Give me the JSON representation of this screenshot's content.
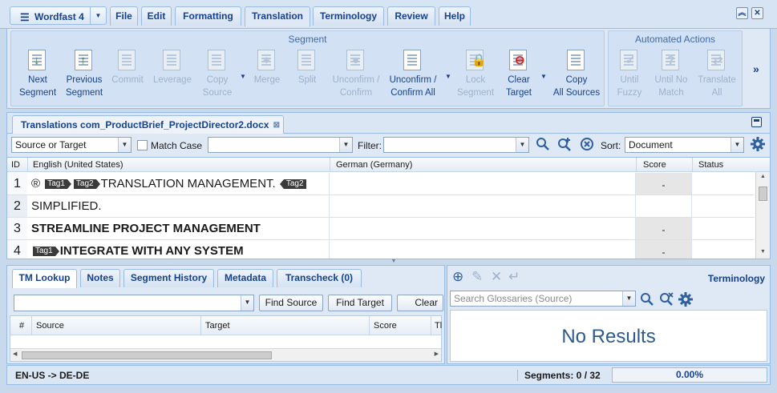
{
  "app": {
    "menu_label": "Wordfast 4"
  },
  "menu_tabs": [
    {
      "label": "File"
    },
    {
      "label": "Edit"
    },
    {
      "label": "Formatting"
    },
    {
      "label": "Translation"
    },
    {
      "label": "Terminology"
    },
    {
      "label": "Review"
    },
    {
      "label": "Help"
    }
  ],
  "active_menu_tab": "Translation",
  "ribbon": {
    "segment_group_title": "Segment",
    "automated_group_title": "Automated Actions",
    "buttons": [
      {
        "l1": "Next",
        "l2": "Segment",
        "enabled": true,
        "icon": "next-segment-icon"
      },
      {
        "l1": "Previous",
        "l2": "Segment",
        "enabled": true,
        "icon": "previous-segment-icon"
      },
      {
        "l1": "Commit",
        "l2": "",
        "enabled": false,
        "icon": "commit-icon"
      },
      {
        "l1": "Leverage",
        "l2": "",
        "enabled": false,
        "icon": "leverage-icon"
      },
      {
        "l1": "Copy",
        "l2": "Source",
        "enabled": false,
        "icon": "copy-source-icon"
      },
      {
        "l1": "Merge",
        "l2": "",
        "enabled": false,
        "icon": "merge-icon"
      },
      {
        "l1": "Split",
        "l2": "",
        "enabled": false,
        "icon": "split-icon"
      },
      {
        "l1": "Unconfirm /",
        "l2": "Confirm",
        "enabled": false,
        "icon": "unconfirm-confirm-icon"
      },
      {
        "l1": "Unconfirm /",
        "l2": "Confirm All",
        "enabled": true,
        "icon": "unconfirm-confirm-all-icon"
      },
      {
        "l1": "Lock",
        "l2": "Segment",
        "enabled": false,
        "icon": "lock-segment-icon"
      },
      {
        "l1": "Clear",
        "l2": "Target",
        "enabled": true,
        "icon": "clear-target-icon"
      },
      {
        "l1": "Copy",
        "l2": "All Sources",
        "enabled": true,
        "icon": "copy-all-sources-icon"
      },
      {
        "l1": "Until",
        "l2": "Fuzzy",
        "enabled": false,
        "icon": "until-fuzzy-icon"
      },
      {
        "l1": "Until No",
        "l2": "Match",
        "enabled": false,
        "icon": "until-no-match-icon"
      },
      {
        "l1": "Translate",
        "l2": "All",
        "enabled": false,
        "icon": "translate-all-icon"
      }
    ],
    "more_label": "»"
  },
  "document": {
    "tab_label": "Translations com_ProductBrief_ProjectDirector2.docx",
    "scope_value": "Source or Target",
    "match_case_label": "Match Case",
    "match_case_checked": false,
    "search_value": "",
    "filter_label": "Filter:",
    "filter_value": "",
    "sort_label": "Sort:",
    "sort_value": "Document"
  },
  "grid": {
    "columns": {
      "id": "ID",
      "source": "English (United States)",
      "target": "German (Germany)",
      "score": "Score",
      "status": "Status"
    },
    "rows": [
      {
        "id": "1",
        "bold": false,
        "parts": [
          {
            "t": "text",
            "v": "® "
          },
          {
            "t": "tag",
            "v": "Tag1",
            "kind": "start"
          },
          {
            "t": "tag",
            "v": "Tag2",
            "kind": "start"
          },
          {
            "t": "text",
            "v": "TRANSLATION MANAGEMENT. "
          },
          {
            "t": "tag",
            "v": "Tag2",
            "kind": "end"
          }
        ],
        "target": "",
        "score": "-"
      },
      {
        "id": "2",
        "bold": false,
        "parts": [
          {
            "t": "text",
            "v": "SIMPLIFIED."
          }
        ],
        "target": "",
        "score": ""
      },
      {
        "id": "3",
        "bold": true,
        "parts": [
          {
            "t": "text",
            "v": "STREAMLINE PROJECT MANAGEMENT"
          }
        ],
        "target": "",
        "score": "-"
      },
      {
        "id": "4",
        "bold": true,
        "parts": [
          {
            "t": "tag",
            "v": "Tag1",
            "kind": "start"
          },
          {
            "t": "text",
            "v": "INTEGRATE WITH ANY SYSTEM"
          }
        ],
        "target": "",
        "score": "-"
      }
    ]
  },
  "bottom_tabs": [
    {
      "label": "TM Lookup"
    },
    {
      "label": "Notes"
    },
    {
      "label": "Segment History"
    },
    {
      "label": "Metadata"
    },
    {
      "label": "Transcheck (0)"
    }
  ],
  "active_bottom_tab": "TM Lookup",
  "tm": {
    "lookup_value": "",
    "find_source_label": "Find Source",
    "find_target_label": "Find Target",
    "clear_label": "Clear",
    "columns": [
      "#",
      "Source",
      "Target",
      "Score",
      "Tl"
    ]
  },
  "terminology": {
    "title": "Terminology",
    "search_placeholder": "Search Glossaries (Source)",
    "no_results": "No Results"
  },
  "status": {
    "languages": "EN-US -> DE-DE",
    "segments": "Segments: 0 / 32",
    "progress": "0.00%"
  },
  "colors": {
    "brand_text": "#15428b",
    "panel_border": "#99bbe8",
    "tag_bg": "#3b3b3b"
  }
}
